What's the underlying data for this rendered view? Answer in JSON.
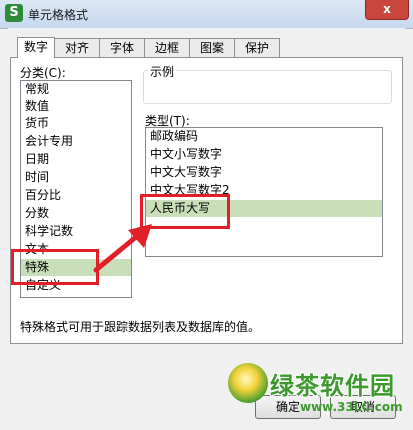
{
  "window": {
    "title": "单元格格式",
    "app_icon": "S",
    "close_label": "x"
  },
  "tabs": [
    "数字",
    "对齐",
    "字体",
    "边框",
    "图案",
    "保护"
  ],
  "category": {
    "label": "分类(C):",
    "items": [
      "常规",
      "数值",
      "货币",
      "会计专用",
      "日期",
      "时间",
      "百分比",
      "分数",
      "科学记数",
      "文本",
      "特殊",
      "自定义"
    ],
    "selected": "特殊"
  },
  "sample": {
    "label": "示例"
  },
  "type": {
    "label": "类型(T):",
    "items": [
      "邮政编码",
      "中文小写数字",
      "中文大写数字",
      "中文大写数字2",
      "人民币大写"
    ],
    "selected": "人民币大写"
  },
  "description": "特殊格式可用于跟踪数据列表及数据库的值。",
  "buttons": {
    "ok": "确定",
    "cancel": "取消"
  },
  "watermark": {
    "text": "绿茶软件园",
    "url": "www.33LC.com"
  },
  "colors": {
    "highlight": "#e21f26",
    "selection": "#c9dfb9",
    "watermark": "#3c9a2d"
  }
}
